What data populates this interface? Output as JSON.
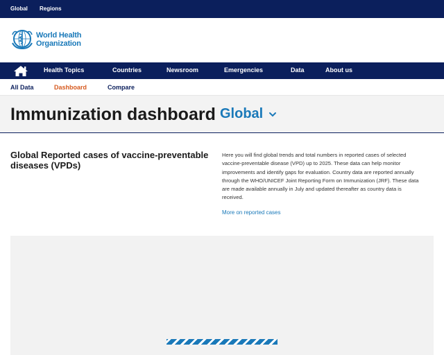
{
  "topbar": {
    "links": [
      "Global",
      "Regions"
    ]
  },
  "logo": {
    "line1": "World Health",
    "line2": "Organization"
  },
  "mainnav": {
    "items": [
      "Health Topics",
      "Countries",
      "Newsroom",
      "Emergencies",
      "Data",
      "About us"
    ]
  },
  "subnav": {
    "items": [
      "All Data",
      "Dashboard",
      "Compare"
    ],
    "active": "Dashboard"
  },
  "banner": {
    "title": "Immunization dashboard",
    "region": "Global"
  },
  "section": {
    "title": "Global Reported cases of vaccine-preventable diseases (VPDs)",
    "description": "Here you will find global trends and total numbers in reported cases of selected vaccine-preventable disease (VPD) up to 2025. These data can help monitor improvements and identify gaps for evaluation. Country data are reported annually through the WHO/UNICEF Joint Reporting Form on Immunization (JRF). These data are made available annually in July and updated thereafter as country data is received.",
    "more_link": "More on reported cases"
  },
  "colors": {
    "navy": "#0b1f5c",
    "who_blue": "#1a79b9",
    "active_orange": "#d65a1f"
  },
  "icons": {
    "home": "home-icon",
    "logo": "who-emblem-icon",
    "chevron": "chevron-down-icon"
  }
}
